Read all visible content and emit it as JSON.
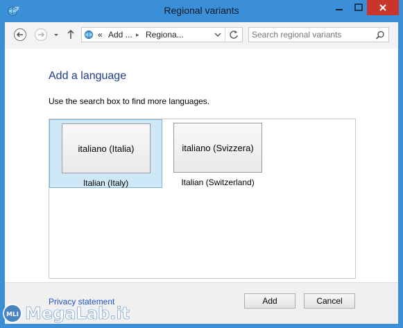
{
  "window": {
    "title": "Regional variants"
  },
  "nav": {
    "breadcrumb": [
      "«",
      "Add ...",
      "▸",
      "Regiona..."
    ],
    "search_placeholder": "Search regional variants"
  },
  "page": {
    "heading": "Add a language",
    "instruction": "Use the search box to find more languages.",
    "languages": [
      {
        "native": "italiano (Italia)",
        "english": "Italian (Italy)",
        "selected": true
      },
      {
        "native": "italiano (Svizzera)",
        "english": "Italian (Switzerland)",
        "selected": false
      }
    ]
  },
  "footer": {
    "privacy_link": "Privacy statement",
    "add_label": "Add",
    "cancel_label": "Cancel"
  },
  "watermark": {
    "text": "MegaLab.it",
    "badge": "MLI"
  },
  "colors": {
    "titlebar": "#3b8fd8",
    "close": "#c7352b",
    "selection": "#cfe8f7",
    "heading": "#1e3c8c",
    "link": "#1e50c8"
  }
}
